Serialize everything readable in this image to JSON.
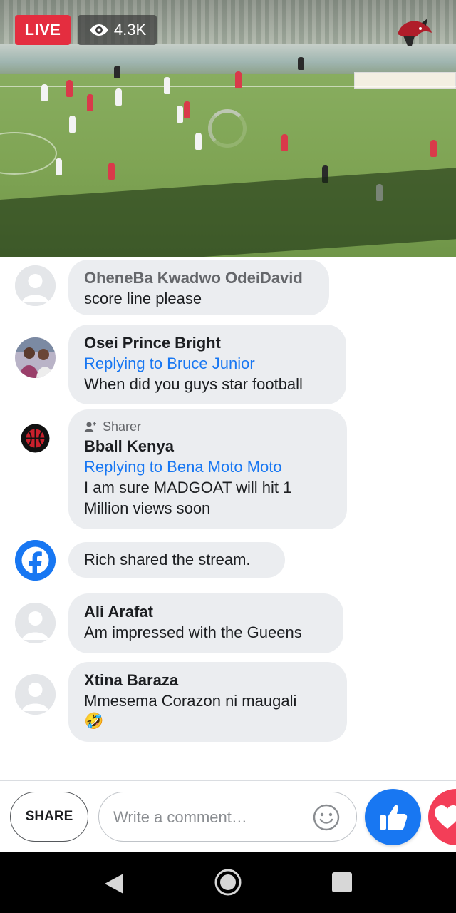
{
  "video": {
    "live_label": "LIVE",
    "view_count": "4.3K",
    "colors": {
      "live_badge": "#e42d3f",
      "accent": "#1877f2"
    }
  },
  "comments": [
    {
      "author": "OheneBa Kwadwo OdeiDavid",
      "text": "score line please",
      "avatar": "default-avatar"
    },
    {
      "author": "Osei Prince Bright",
      "reply_to": "Replying to Bruce Junior",
      "text": "When did you guys star football",
      "avatar": "photo-avatar"
    },
    {
      "sharer_label": "Sharer",
      "author": "Bball Kenya",
      "reply_to": "Replying to Bena Moto Moto",
      "text_line1": "I am sure MADGOAT will hit 1",
      "text_line2": "Million views soon",
      "avatar": "basketball-logo-avatar"
    },
    {
      "text": "Rich shared the stream.",
      "avatar": "facebook-icon"
    },
    {
      "author": "Ali Arafat",
      "text": "Am impressed with the Gueens",
      "avatar": "default-avatar"
    },
    {
      "author": "Xtina Baraza",
      "text": "Mmesema Corazon ni maugali",
      "emoji": "🤣",
      "avatar": "default-avatar"
    }
  ],
  "bottom_bar": {
    "share_label": "SHARE",
    "comment_placeholder": "Write a comment…",
    "like_icon": "thumbs-up-icon",
    "love_icon": "heart-icon"
  }
}
